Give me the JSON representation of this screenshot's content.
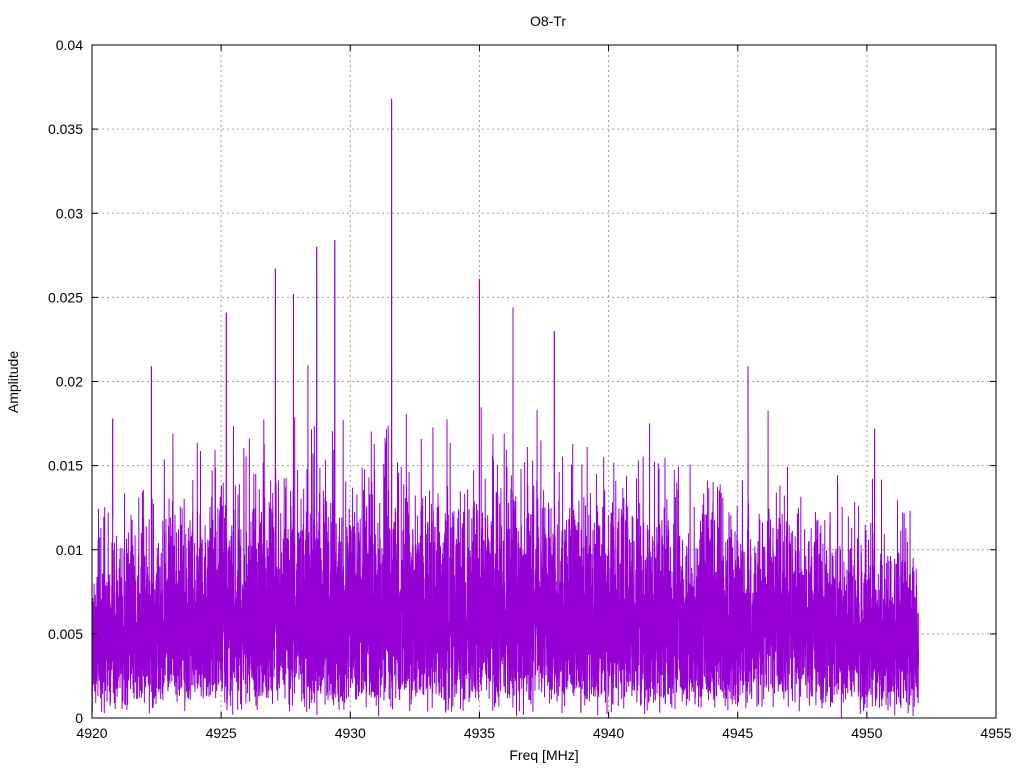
{
  "chart_data": {
    "type": "line",
    "title": "O8-Tr",
    "xlabel": "Freq [MHz]",
    "ylabel": "Amplitude",
    "xlim": [
      4920,
      4955
    ],
    "ylim": [
      0,
      0.04
    ],
    "xticks": [
      "4920",
      "4925",
      "4930",
      "4935",
      "4940",
      "4945",
      "4950",
      "4955"
    ],
    "xtick_values": [
      4920,
      4925,
      4930,
      4935,
      4940,
      4945,
      4950,
      4955
    ],
    "yticks": [
      "0",
      "0.005",
      "0.01",
      "0.015",
      "0.02",
      "0.025",
      "0.03",
      "0.035",
      "0.04"
    ],
    "ytick_values": [
      0,
      0.005,
      0.01,
      0.015,
      0.02,
      0.025,
      0.03,
      0.035,
      0.04
    ],
    "grid": true,
    "series": [
      {
        "name": "O8-Tr",
        "color": "#9400d3",
        "x_range": [
          4920,
          4952
        ],
        "x_step": 0.004,
        "noise_sigma_profile": [
          [
            4920,
            0.0038
          ],
          [
            4925,
            0.0048
          ],
          [
            4930,
            0.0052
          ],
          [
            4935,
            0.005
          ],
          [
            4940,
            0.0047
          ],
          [
            4945,
            0.0045
          ],
          [
            4950,
            0.0042
          ],
          [
            4952,
            0.0035
          ]
        ],
        "peaks": [
          [
            4920.8,
            0.0178
          ],
          [
            4922.3,
            0.0209
          ],
          [
            4925.2,
            0.0241
          ],
          [
            4927.1,
            0.0267
          ],
          [
            4927.8,
            0.0252
          ],
          [
            4928.7,
            0.028
          ],
          [
            4929.4,
            0.0284
          ],
          [
            4931.6,
            0.0368
          ],
          [
            4935.0,
            0.0261
          ],
          [
            4936.3,
            0.0244
          ],
          [
            4937.9,
            0.023
          ],
          [
            4945.4,
            0.0209
          ],
          [
            4950.3,
            0.0172
          ]
        ]
      }
    ]
  }
}
